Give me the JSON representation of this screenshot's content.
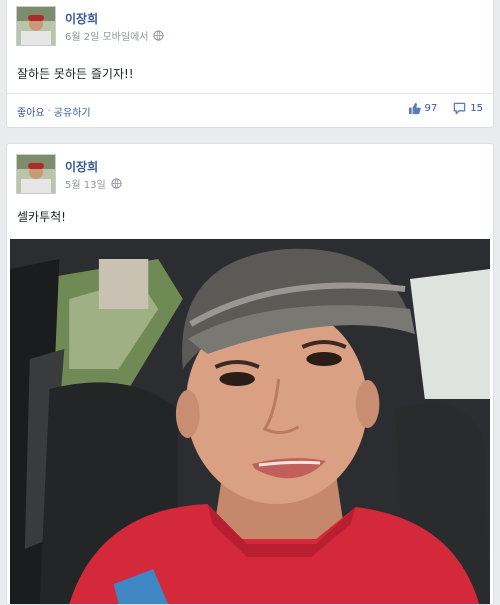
{
  "posts": [
    {
      "author": "이장희",
      "timestamp": "6월 2일 모바일에서",
      "privacy_icon": "globe-icon",
      "text": "잘하든 못하든 즐기자!!",
      "actions": {
        "like": "좋아요",
        "separator": "·",
        "share": "공유하기"
      },
      "likes": "97",
      "comments": "15"
    },
    {
      "author": "이장희",
      "timestamp": "5월 13일",
      "privacy_icon": "globe-icon",
      "text": "셀카투척!"
    }
  ],
  "colors": {
    "link_blue": "#365899",
    "meta_gray": "#90949c",
    "background": "#e9ebee",
    "card": "#ffffff"
  },
  "icons": {
    "like": "thumbs-up-icon",
    "comment": "comment-icon"
  }
}
